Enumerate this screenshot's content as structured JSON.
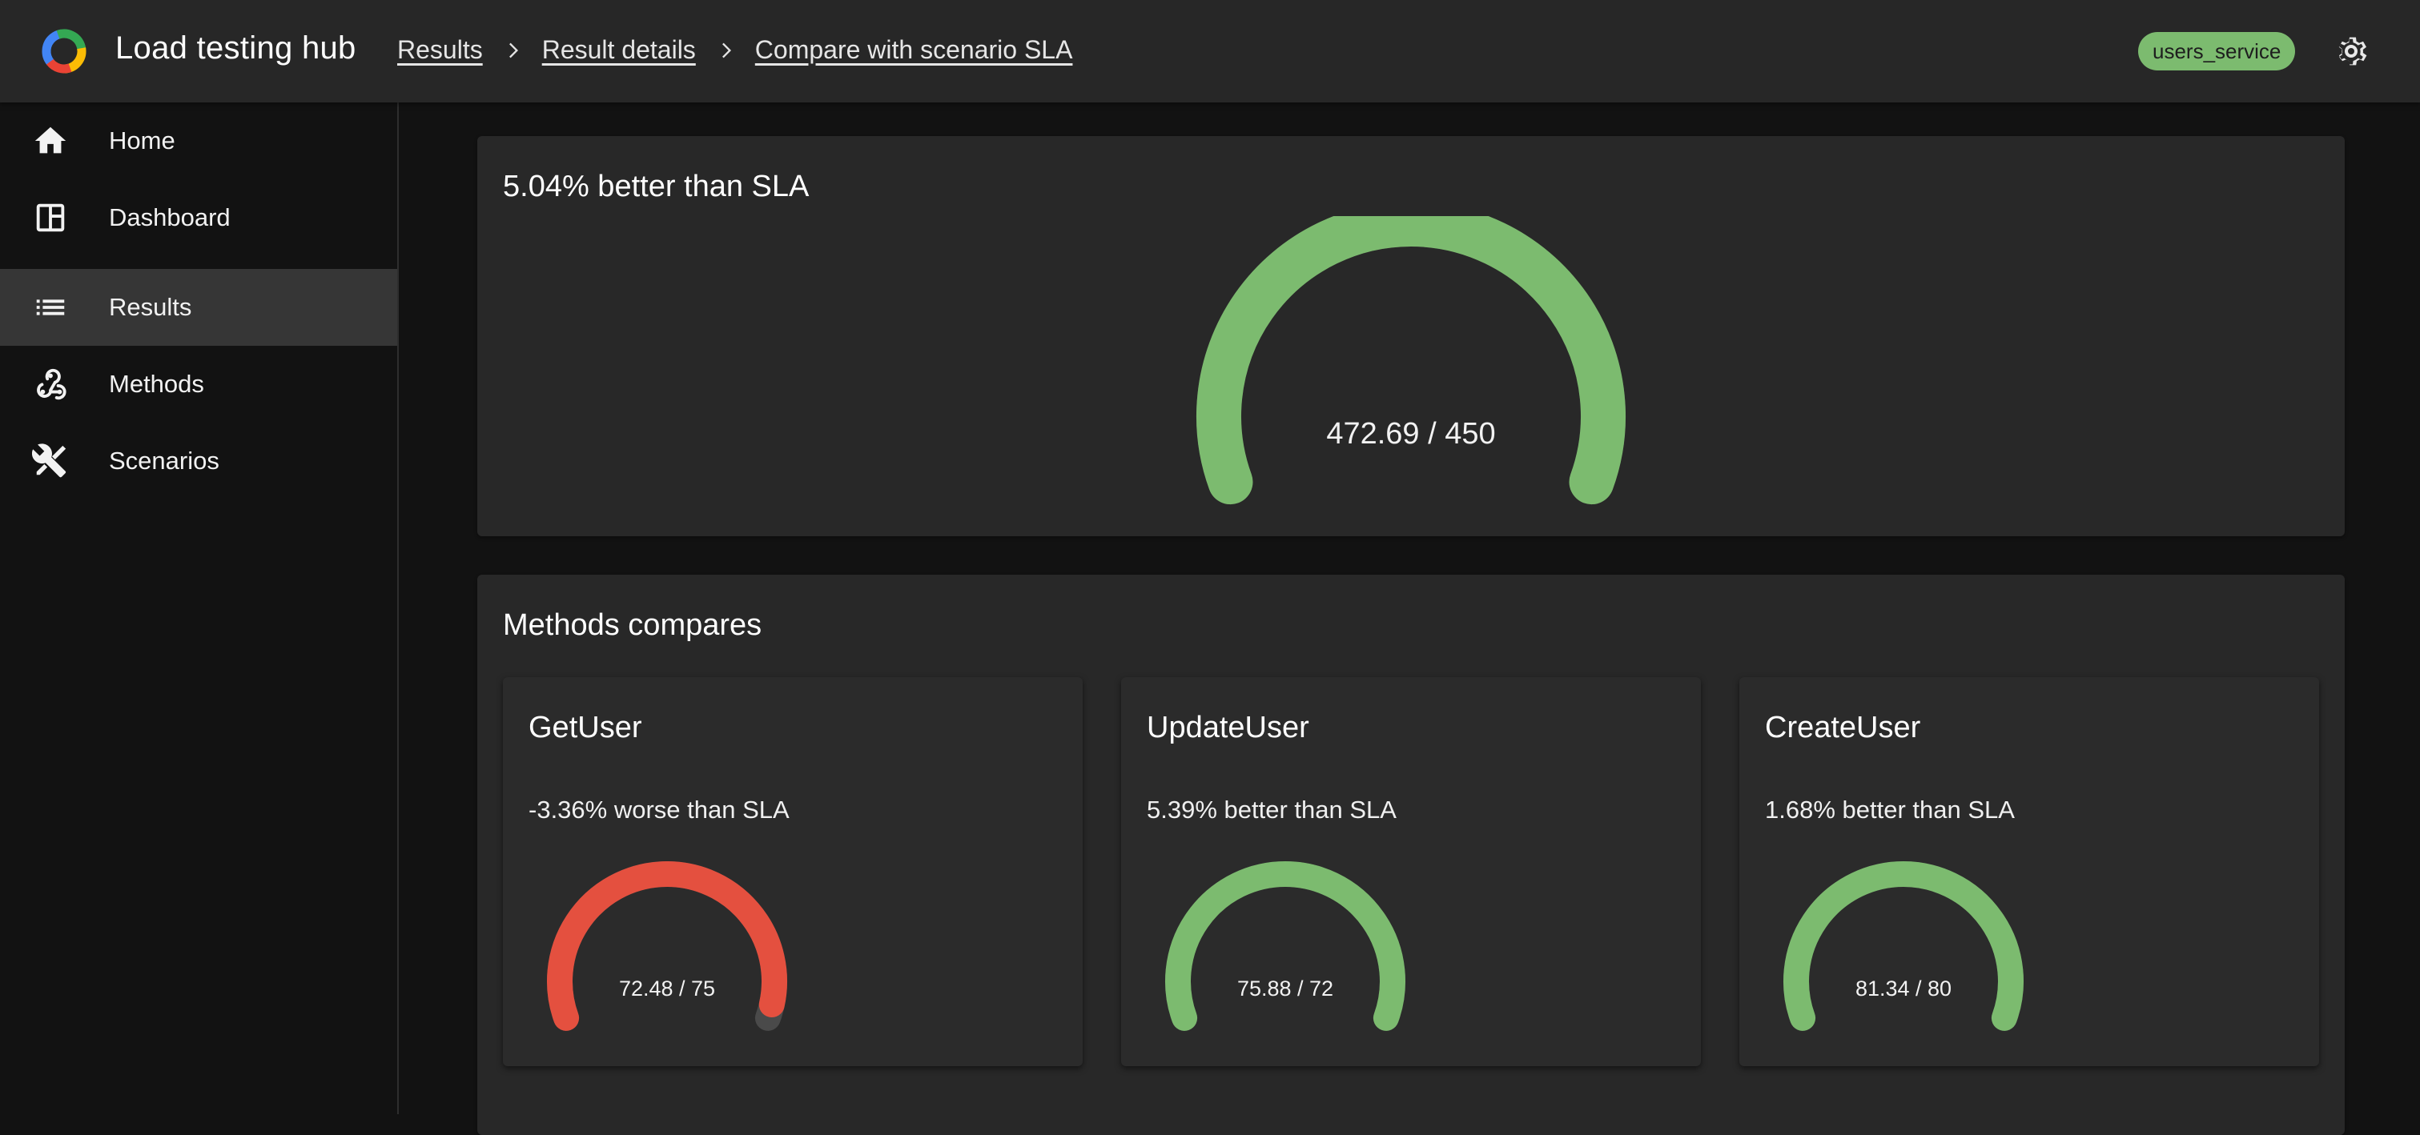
{
  "header": {
    "app_title": "Load testing hub",
    "breadcrumbs": [
      "Results",
      "Result details",
      "Compare with scenario SLA"
    ],
    "service_badge": "users_service",
    "icons": {
      "logo": "app-logo-icon",
      "settings": "gear-icon",
      "separator": "chevron-right-icon"
    }
  },
  "sidebar": {
    "items": [
      {
        "label": "Home",
        "icon": "home-icon",
        "active": false
      },
      {
        "label": "Dashboard",
        "icon": "dashboard-icon",
        "active": false
      },
      {
        "label": "Results",
        "icon": "list-icon",
        "active": true
      },
      {
        "label": "Methods",
        "icon": "webhook-icon",
        "active": false
      },
      {
        "label": "Scenarios",
        "icon": "tools-icon",
        "active": false
      }
    ]
  },
  "summary": {
    "title": "5.04% better than SLA",
    "gauge_label": "472.69 / 450",
    "actual": 472.69,
    "sla": 450,
    "fill_fraction": 1.0
  },
  "methods": {
    "title": "Methods compares",
    "items": [
      {
        "name": "GetUser",
        "status": "-3.36% worse than SLA",
        "gauge_label": "72.48 / 75",
        "actual": 72.48,
        "sla": 75,
        "fill_fraction": 0.966
      },
      {
        "name": "UpdateUser",
        "status": "5.39% better than SLA",
        "gauge_label": "75.88 / 72",
        "actual": 75.88,
        "sla": 72,
        "fill_fraction": 1.0
      },
      {
        "name": "CreateUser",
        "status": "1.68% better than SLA",
        "gauge_label": "81.34 / 80",
        "actual": 81.34,
        "sla": 80,
        "fill_fraction": 1.0
      }
    ]
  },
  "colors": {
    "good": "#7cbb6f",
    "bad": "#e4503f",
    "track": "#4a4a4a",
    "badge": "#7cbb6f"
  }
}
